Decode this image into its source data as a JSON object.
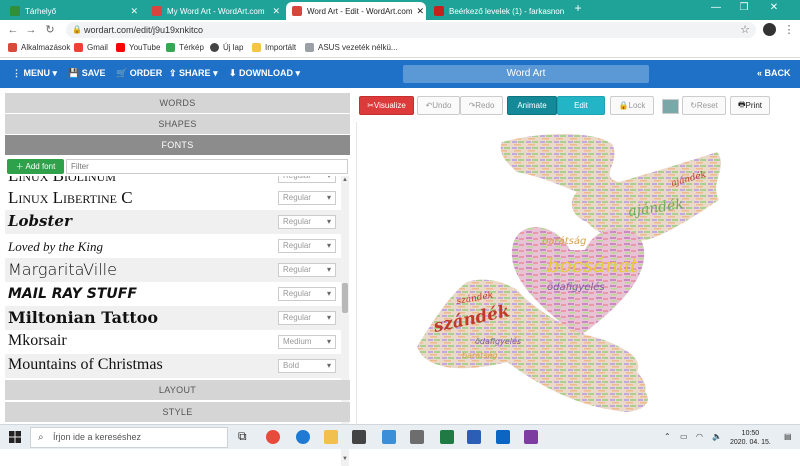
{
  "browser": {
    "tabs": [
      {
        "label": "Tárhelyő",
        "active": false,
        "color": "#2f8f3a"
      },
      {
        "label": "My Word Art - WordArt.com",
        "active": false,
        "color": "#d8453f"
      },
      {
        "label": "Word Art - Edit - WordArt.com",
        "active": true,
        "color": "#d8453f"
      },
      {
        "label": "Beérkező levelek (1) - farkasnon",
        "active": false,
        "color": "#c5221f"
      }
    ],
    "new_tab": "+",
    "url": "wordart.com/edit/j9u19xnkitco",
    "bookmarks": [
      "Alkalmazások",
      "Gmail",
      "YouTube",
      "Térkép",
      "Új lap",
      "Importált",
      "ASUS vezeték nélkü..."
    ]
  },
  "appbar": {
    "menu": "MENU",
    "save": "SAVE",
    "order": "ORDER",
    "share": "SHARE",
    "download": "DOWNLOAD",
    "title": "Word Art",
    "back": "BACK"
  },
  "left_panel": {
    "sections": {
      "words": "WORDS",
      "shapes": "SHAPES",
      "fonts": "FONTS",
      "layout": "LAYOUT",
      "style": "STYLE"
    },
    "add_font": "Add font",
    "filter_placeholder": "Filter",
    "fonts": [
      {
        "name": "Linux Biolinum",
        "style": "Regular"
      },
      {
        "name": "Linux Libertine C",
        "style": "Regular"
      },
      {
        "name": "Lobster",
        "style": "Regular"
      },
      {
        "name": "Loved by the King",
        "style": "Regular"
      },
      {
        "name": "MargaritaVille",
        "style": "Regular"
      },
      {
        "name": "MAIL RAY STUFF",
        "style": "Regular"
      },
      {
        "name": "Miltonian Tattoo",
        "style": "Regular"
      },
      {
        "name": "Mkorsair",
        "style": "Medium"
      },
      {
        "name": "Mountains of Christmas",
        "style": "Bold"
      }
    ]
  },
  "toolbar": {
    "visualize": "Visualize",
    "undo": "Undo",
    "redo": "Redo",
    "animate": "Animate",
    "edit": "Edit",
    "lock": "Lock",
    "reset": "Reset",
    "print": "Print",
    "color_swatch": "#7aa8a8"
  },
  "canvas": {
    "words": [
      "bocsánat",
      "szándék",
      "barátság",
      "ajándék",
      "ödafigyelés",
      "szándék",
      "barátság",
      "ajándék",
      "ödafigyelés"
    ]
  },
  "taskbar": {
    "search_placeholder": "Írjon ide a kereséshez",
    "time": "10:50",
    "date": "2020. 04. 15."
  }
}
